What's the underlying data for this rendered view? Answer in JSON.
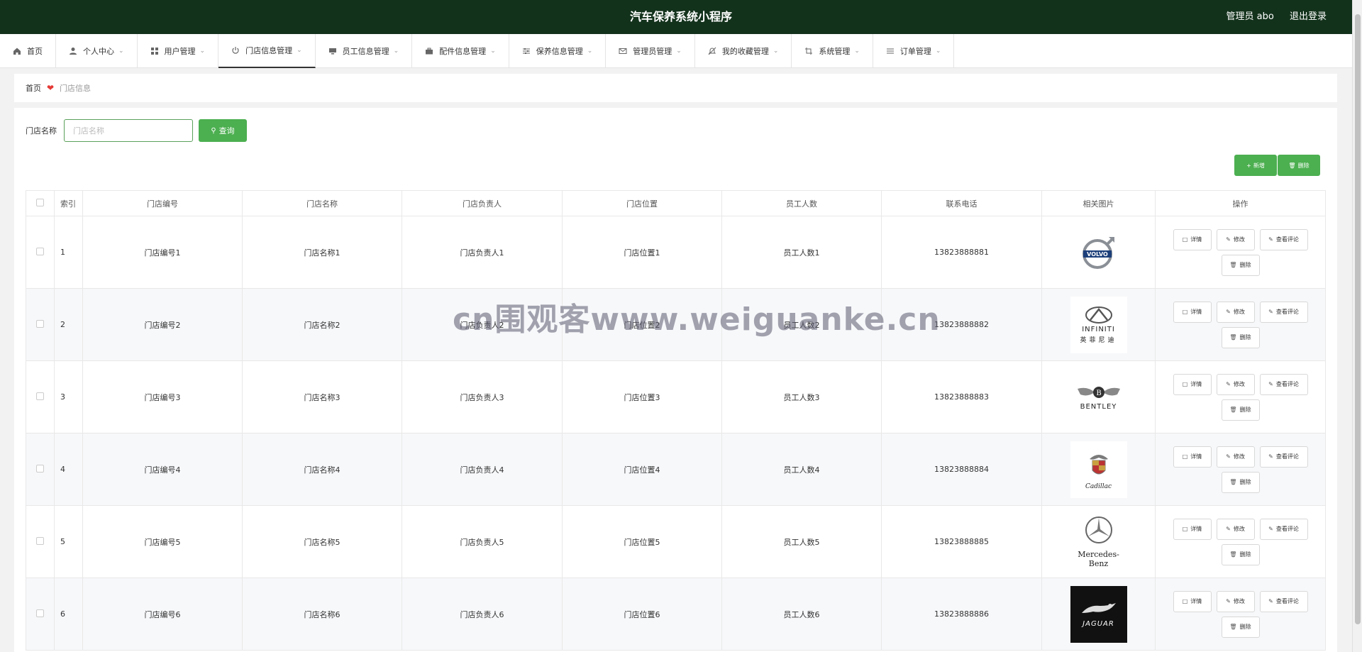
{
  "header": {
    "title": "汽车保养系统小程序",
    "user": "管理员 abo",
    "logout": "退出登录"
  },
  "nav": [
    {
      "label": "首页",
      "icon": "home-icon",
      "chev": false
    },
    {
      "label": "个人中心",
      "icon": "user-icon",
      "chev": true
    },
    {
      "label": "用户管理",
      "icon": "grid-icon",
      "chev": true
    },
    {
      "label": "门店信息管理",
      "icon": "power-icon",
      "chev": true,
      "active": true
    },
    {
      "label": "员工信息管理",
      "icon": "monitor-icon",
      "chev": true
    },
    {
      "label": "配件信息管理",
      "icon": "briefcase-icon",
      "chev": true
    },
    {
      "label": "保养信息管理",
      "icon": "sliders-icon",
      "chev": true
    },
    {
      "label": "管理员管理",
      "icon": "mail-icon",
      "chev": true
    },
    {
      "label": "我的收藏管理",
      "icon": "bell-icon",
      "chev": true
    },
    {
      "label": "系统管理",
      "icon": "crop-icon",
      "chev": true
    },
    {
      "label": "订单管理",
      "icon": "list-icon",
      "chev": true
    }
  ],
  "breadcrumb": {
    "home": "首页",
    "current": "门店信息"
  },
  "search": {
    "label": "门店名称",
    "placeholder": "门店名称",
    "button": "查询"
  },
  "tools": {
    "add": "新增",
    "delete": "删除"
  },
  "table": {
    "headers": [
      "索引",
      "门店编号",
      "门店名称",
      "门店负责人",
      "门店位置",
      "员工人数",
      "联系电话",
      "相关图片",
      "操作"
    ],
    "rows": [
      {
        "index": "1",
        "code": "门店编号1",
        "name": "门店名称1",
        "manager": "门店负责人1",
        "location": "门店位置1",
        "staff": "员工人数1",
        "phone": "13823888881",
        "brand": "VOLVO"
      },
      {
        "index": "2",
        "code": "门店编号2",
        "name": "门店名称2",
        "manager": "门店负责人2",
        "location": "门店位置2",
        "staff": "员工人数2",
        "phone": "13823888882",
        "brand": "INFINITI",
        "brand_sub": "英菲尼迪"
      },
      {
        "index": "3",
        "code": "门店编号3",
        "name": "门店名称3",
        "manager": "门店负责人3",
        "location": "门店位置3",
        "staff": "员工人数3",
        "phone": "13823888883",
        "brand": "BENTLEY"
      },
      {
        "index": "4",
        "code": "门店编号4",
        "name": "门店名称4",
        "manager": "门店负责人4",
        "location": "门店位置4",
        "staff": "员工人数4",
        "phone": "13823888884",
        "brand": "Cadillac"
      },
      {
        "index": "5",
        "code": "门店编号5",
        "name": "门店名称5",
        "manager": "门店负责人5",
        "location": "门店位置5",
        "staff": "员工人数5",
        "phone": "13823888885",
        "brand": "Mercedes-Benz"
      },
      {
        "index": "6",
        "code": "门店编号6",
        "name": "门店名称6",
        "manager": "门店负责人6",
        "location": "门店位置6",
        "staff": "员工人数6",
        "phone": "13823888886",
        "brand": "JAGUAR"
      }
    ],
    "actions": {
      "detail": "详情",
      "edit": "修改",
      "comments": "查看评论",
      "delete": "删除"
    }
  },
  "watermark": "cn围观客www.weiguanke.cn",
  "colors": {
    "header_bg": "#13321c",
    "accent": "#4caf50"
  }
}
